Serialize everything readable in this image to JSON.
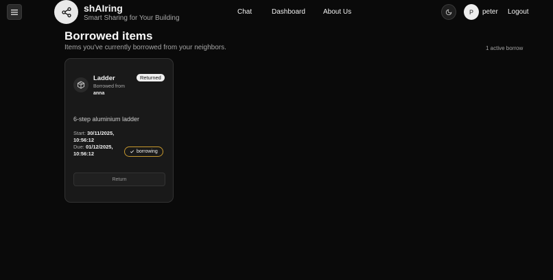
{
  "header": {
    "brand_title": "shAIring",
    "brand_subtitle": "Smart Sharing for Your Building",
    "nav": {
      "chat": "Chat",
      "dashboard": "Dashboard",
      "about": "About Us"
    },
    "avatar_initial": "P",
    "username": "peter",
    "logout": "Logout",
    "icons": {
      "menu": "menu-icon",
      "logo": "share-icon",
      "theme": "moon-icon"
    }
  },
  "page": {
    "title": "Borrowed items",
    "subtitle": "Items you've currently borrowed from your neighbors.",
    "count_text": "1 active borrow"
  },
  "items": [
    {
      "name": "Ladder",
      "status": "Returned",
      "borrowed_from_label": "Borrowed from",
      "owner": "anna",
      "description": "6-step aluminium ladder",
      "start_label": "Start:",
      "start_value": "30/11/2025, 10:56:12",
      "due_label": "Due:",
      "due_value": "01/12/2025, 10:56:12",
      "state_badge": "borrowing",
      "return_label": "Return",
      "icon": "package-icon"
    }
  ],
  "colors": {
    "background": "#0a0a0a",
    "card": "#191919",
    "badge_border": "#c99a2e"
  }
}
